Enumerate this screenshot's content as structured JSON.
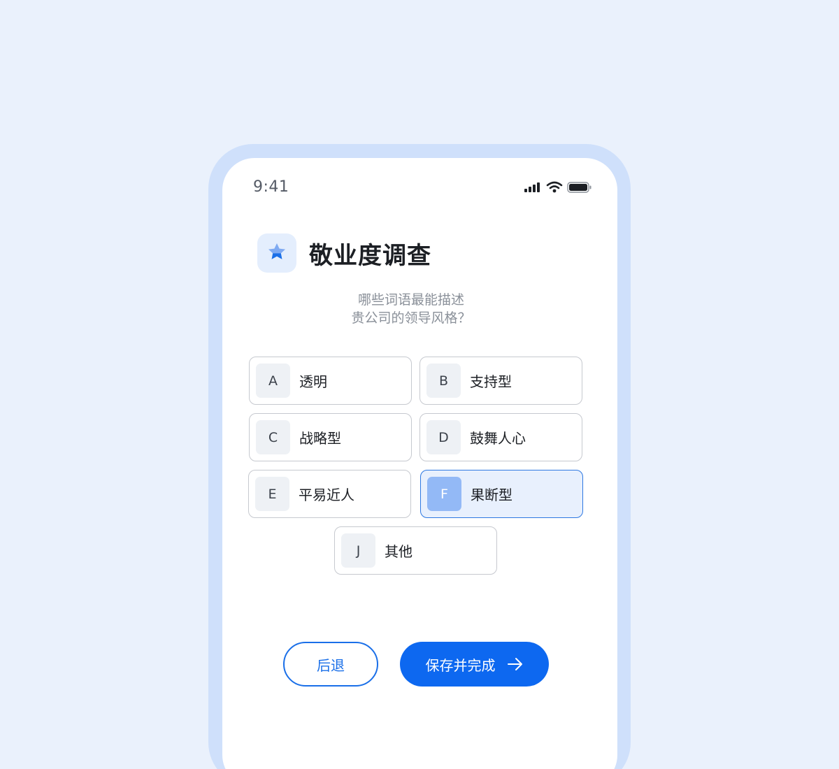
{
  "status_bar": {
    "time": "9:41",
    "icons": [
      "signal-icon",
      "wifi-icon",
      "battery-icon"
    ]
  },
  "header": {
    "title": "敬业度调查",
    "logo_icon": "star-icon"
  },
  "question": {
    "line1": "哪些词语最能描述",
    "line2": "贵公司的领导风格？"
  },
  "options": [
    {
      "key": "A",
      "label": "透明",
      "selected": false
    },
    {
      "key": "B",
      "label": "支持型",
      "selected": false
    },
    {
      "key": "C",
      "label": "战略型",
      "selected": false
    },
    {
      "key": "D",
      "label": "鼓舞人心",
      "selected": false
    },
    {
      "key": "E",
      "label": "平易近人",
      "selected": false
    },
    {
      "key": "F",
      "label": "果断型",
      "selected": true
    },
    {
      "key": "J",
      "label": "其他",
      "selected": false
    }
  ],
  "actions": {
    "back_label": "后退",
    "finish_label": "保存并完成",
    "finish_icon": "arrow-right-icon"
  },
  "colors": {
    "background": "#EAF1FC",
    "accent": "#0D68F0",
    "selected_fill": "#E8F0FD",
    "selected_key": "#93B9F6"
  }
}
